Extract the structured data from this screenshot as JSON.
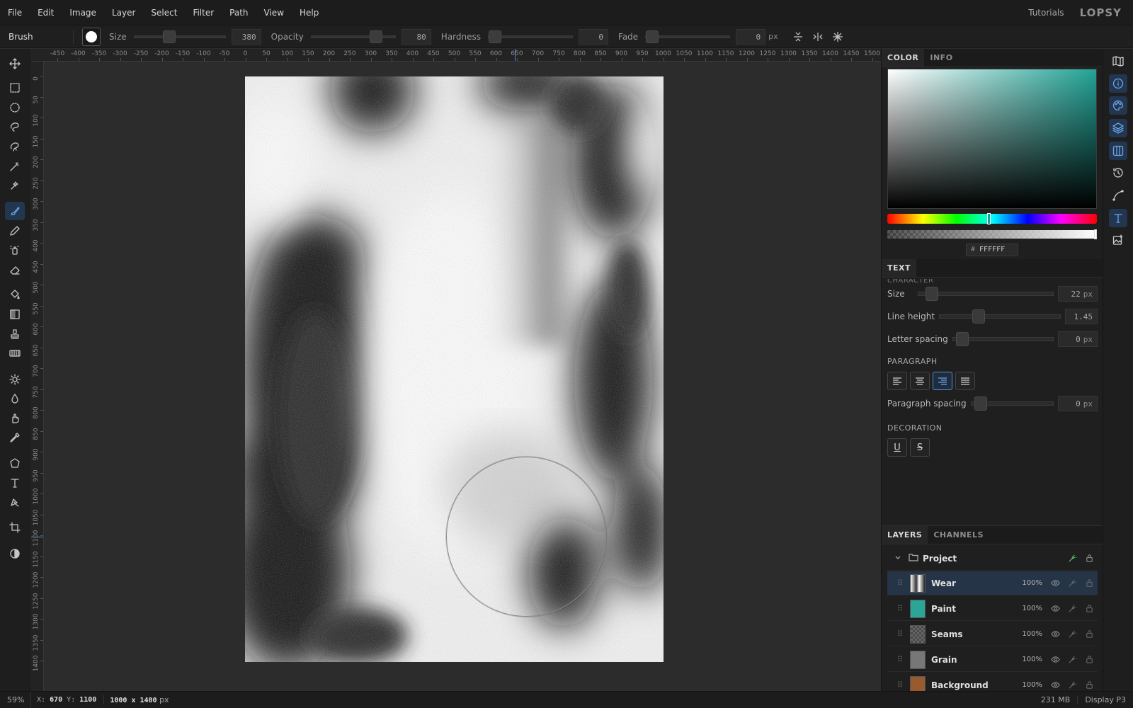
{
  "menu": [
    "File",
    "Edit",
    "Image",
    "Layer",
    "Select",
    "Filter",
    "Path",
    "View",
    "Help"
  ],
  "header": {
    "tutorials": "Tutorials",
    "logo": "LOPSY"
  },
  "options": {
    "tool": "Brush",
    "size_label": "Size",
    "size_value": "380",
    "size_level": 0.36,
    "opacity_label": "Opacity",
    "opacity_value": "80",
    "opacity_level": 0.8,
    "hardness_label": "Hardness",
    "hardness_value": "0",
    "hardness_level": 0,
    "fade_label": "Fade",
    "fade_value": "0",
    "fade_unit": "px",
    "fade_level": 0
  },
  "tools": [
    "move-icon",
    "rect-select-icon",
    "ellipse-select-icon",
    "lasso-icon",
    "magnetic-lasso-icon",
    "magic-wand-icon",
    "quick-select-icon",
    "brush-icon",
    "pencil-icon",
    "spray-icon",
    "eraser-icon",
    "bucket-icon",
    "gradient-icon",
    "stamp-icon",
    "pattern-icon",
    "dodge-icon",
    "blur-icon",
    "smudge-icon",
    "eyedropper-icon",
    "polygon-icon",
    "text-icon",
    "pen-icon",
    "crop-icon",
    "contrast-icon"
  ],
  "ruler": {
    "top": [
      "-450",
      "-400",
      "-350",
      "-300",
      "-250",
      "-200",
      "-150",
      "-100",
      "-50",
      "0",
      "50",
      "100",
      "150",
      "200",
      "250",
      "300",
      "350",
      "400",
      "450",
      "500",
      "550",
      "600",
      "650",
      "700",
      "750",
      "800",
      "850",
      "900",
      "950",
      "1000",
      "1050",
      "1100",
      "1150",
      "1200",
      "1250",
      "1300",
      "1350",
      "1400",
      "1450",
      "1500"
    ],
    "left": [
      "0",
      "50",
      "100",
      "150",
      "200",
      "250",
      "300",
      "350",
      "400",
      "450",
      "500",
      "550",
      "600",
      "650",
      "700",
      "750",
      "800",
      "850",
      "900",
      "950",
      "1000",
      "1050",
      "1100",
      "1150",
      "1200",
      "1250",
      "1300",
      "1350",
      "1400"
    ]
  },
  "color_panel": {
    "tabs": [
      "COLOR",
      "INFO"
    ],
    "hash": "#",
    "hex": "FFFFFF",
    "hue_color": "#1ba092"
  },
  "text_panel": {
    "tab": "TEXT",
    "cut_heading": "CHARACTER",
    "size_label": "Size",
    "size_value": "22",
    "size_unit": "px",
    "line_height_label": "Line height",
    "line_height_value": "1.45",
    "letter_spacing_label": "Letter spacing",
    "letter_spacing_value": "0",
    "letter_spacing_unit": "px",
    "paragraph_title": "PARAGRAPH",
    "paragraph_spacing_label": "Paragraph spacing",
    "paragraph_spacing_value": "0",
    "paragraph_spacing_unit": "px",
    "decoration_title": "DECORATION",
    "underline": "U",
    "strike": "S"
  },
  "layers_panel": {
    "tabs": [
      "LAYERS",
      "CHANNELS"
    ],
    "group": "Project",
    "layers": [
      {
        "name": "Wear",
        "opacity": "100%",
        "thumb": "#dcdcdc"
      },
      {
        "name": "Paint",
        "opacity": "100%",
        "thumb": "#2aa596"
      },
      {
        "name": "Seams",
        "opacity": "100%",
        "thumb": "checker"
      },
      {
        "name": "Grain",
        "opacity": "100%",
        "thumb": "#777777"
      },
      {
        "name": "Background",
        "opacity": "100%",
        "thumb": "#9a5a30"
      }
    ]
  },
  "status": {
    "zoom": "59%",
    "x_label": "X:",
    "x": "670",
    "y_label": "Y:",
    "y": "1100",
    "dims": "1000 x 1400",
    "dims_unit": "px",
    "memory": "231 MB",
    "profile": "Display P3"
  }
}
